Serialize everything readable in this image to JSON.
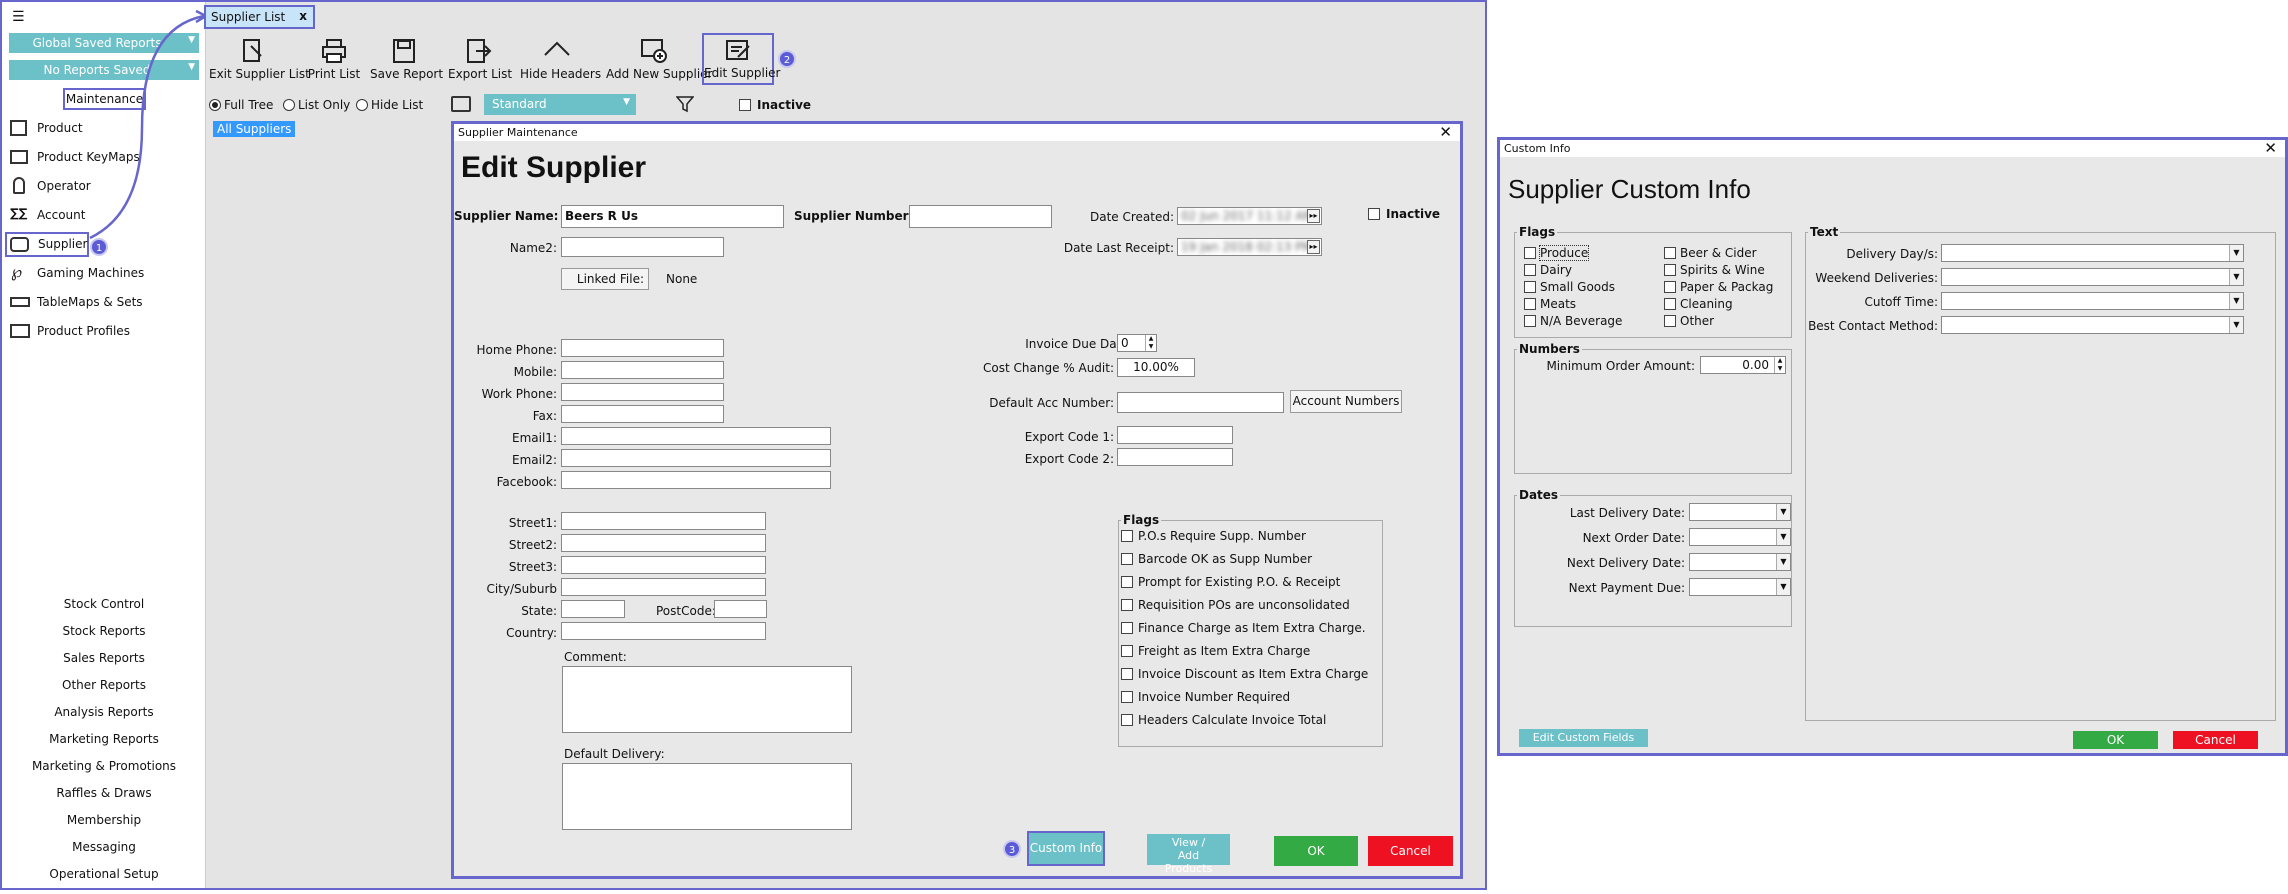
{
  "colors": {
    "accent": "#6cc0c8",
    "highlight": "#6666cc",
    "ok": "#33aa44",
    "cancel": "#ee1122",
    "selection": "#3399ff"
  },
  "sidebar": {
    "global_saved": "Global Saved Reports",
    "no_reports": "No Reports Saved",
    "maintenance": "Maintenance",
    "items": [
      {
        "label": "Product",
        "icon": "product-icon"
      },
      {
        "label": "Product KeyMaps",
        "icon": "keymap-icon"
      },
      {
        "label": "Operator",
        "icon": "operator-icon"
      },
      {
        "label": "Account",
        "icon": "account-icon"
      },
      {
        "label": "Supplier",
        "icon": "supplier-icon"
      },
      {
        "label": "Gaming Machines",
        "icon": "gaming-icon"
      },
      {
        "label": "TableMaps & Sets",
        "icon": "tablemap-icon"
      },
      {
        "label": "Product Profiles",
        "icon": "profile-icon"
      }
    ],
    "modules": [
      "Stock Control",
      "Stock Reports",
      "Sales Reports",
      "Other Reports",
      "Analysis Reports",
      "Marketing Reports",
      "Marketing & Promotions",
      "Raffles & Draws",
      "Membership",
      "Messaging",
      "Operational Setup"
    ]
  },
  "badges": [
    "1",
    "2",
    "3"
  ],
  "tab": {
    "label": "Supplier List",
    "close": "x"
  },
  "toolbar": {
    "exit": "Exit Supplier List",
    "print": "Print List",
    "save": "Save Report",
    "export": "Export List",
    "hide": "Hide Headers",
    "add": "Add New Supplier",
    "edit": "Edit Supplier"
  },
  "view": {
    "full_tree": "Full Tree",
    "list_only": "List Only",
    "hide_list": "Hide List",
    "layout": "Standard",
    "inactive": "Inactive",
    "all_suppliers": "All Suppliers"
  },
  "edit": {
    "window_title": "Supplier Maintenance",
    "title": "Edit Supplier",
    "supplier_name_label": "Supplier Name:",
    "supplier_name": "Beers R Us",
    "supplier_number_label": "Supplier Number:",
    "supplier_number": "",
    "date_created_label": "Date Created:",
    "date_created": "02 Jun 2017 11:12 AM",
    "inactive_label": "Inactive",
    "name2_label": "Name2:",
    "linked_file_btn": "Linked File:",
    "linked_file_value": "None",
    "date_last_receipt_label": "Date Last Receipt:",
    "date_last_receipt": "19 Jan 2018 02:13 PM",
    "home_phone": "Home Phone:",
    "mobile": "Mobile:",
    "work_phone": "Work Phone:",
    "fax": "Fax:",
    "email1": "Email1:",
    "email2": "Email2:",
    "facebook": "Facebook:",
    "street1": "Street1:",
    "street2": "Street2:",
    "street3": "Street3:",
    "city": "City/Suburb",
    "state": "State:",
    "postcode": "PostCode:",
    "country": "Country:",
    "comment": "Comment:",
    "default_delivery": "Default Delivery:",
    "invoice_due_label": "Invoice Due Days:",
    "invoice_due": "0",
    "cost_change_label": "Cost Change % Audit:",
    "cost_change": "10.00%",
    "default_acc_label": "Default Acc Number:",
    "account_numbers_btn": "Account Numbers",
    "export1": "Export Code 1:",
    "export2": "Export Code 2:",
    "flags_title": "Flags",
    "flags": [
      "P.O.s Require Supp. Number",
      "Barcode OK as Supp Number",
      "Prompt for Existing P.O. & Receipt",
      "Requisition POs are unconsolidated",
      "Finance Charge as Item Extra Charge.",
      "Freight as Item Extra Charge",
      "Invoice Discount as Item Extra Charge",
      "Invoice Number Required",
      "Headers Calculate Invoice Total"
    ],
    "custom_info_btn": "Custom Info",
    "view_add_products_btn": "View / Add Products",
    "ok": "OK",
    "cancel": "Cancel"
  },
  "custom": {
    "window_title": "Custom Info",
    "title": "Supplier Custom Info",
    "flags_title": "Flags",
    "flags_col1": [
      "Produce",
      "Dairy",
      "Small Goods",
      "Meats",
      "N/A Beverage"
    ],
    "flags_col2": [
      "Beer & Cider",
      "Spirits & Wine",
      "Paper & Packag",
      "Cleaning",
      "Other"
    ],
    "numbers_title": "Numbers",
    "min_order_label": "Minimum Order Amount:",
    "min_order": "0.00",
    "dates_title": "Dates",
    "dates": [
      "Last Delivery Date:",
      "Next Order Date:",
      "Next Delivery Date:",
      "Next Payment Due:"
    ],
    "text_title": "Text",
    "text_fields": [
      "Delivery Day/s:",
      "Weekend Deliveries:",
      "Cutoff Time:",
      "Best Contact Method:"
    ],
    "edit_fields_btn": "Edit Custom Fields",
    "ok": "OK",
    "cancel": "Cancel"
  }
}
